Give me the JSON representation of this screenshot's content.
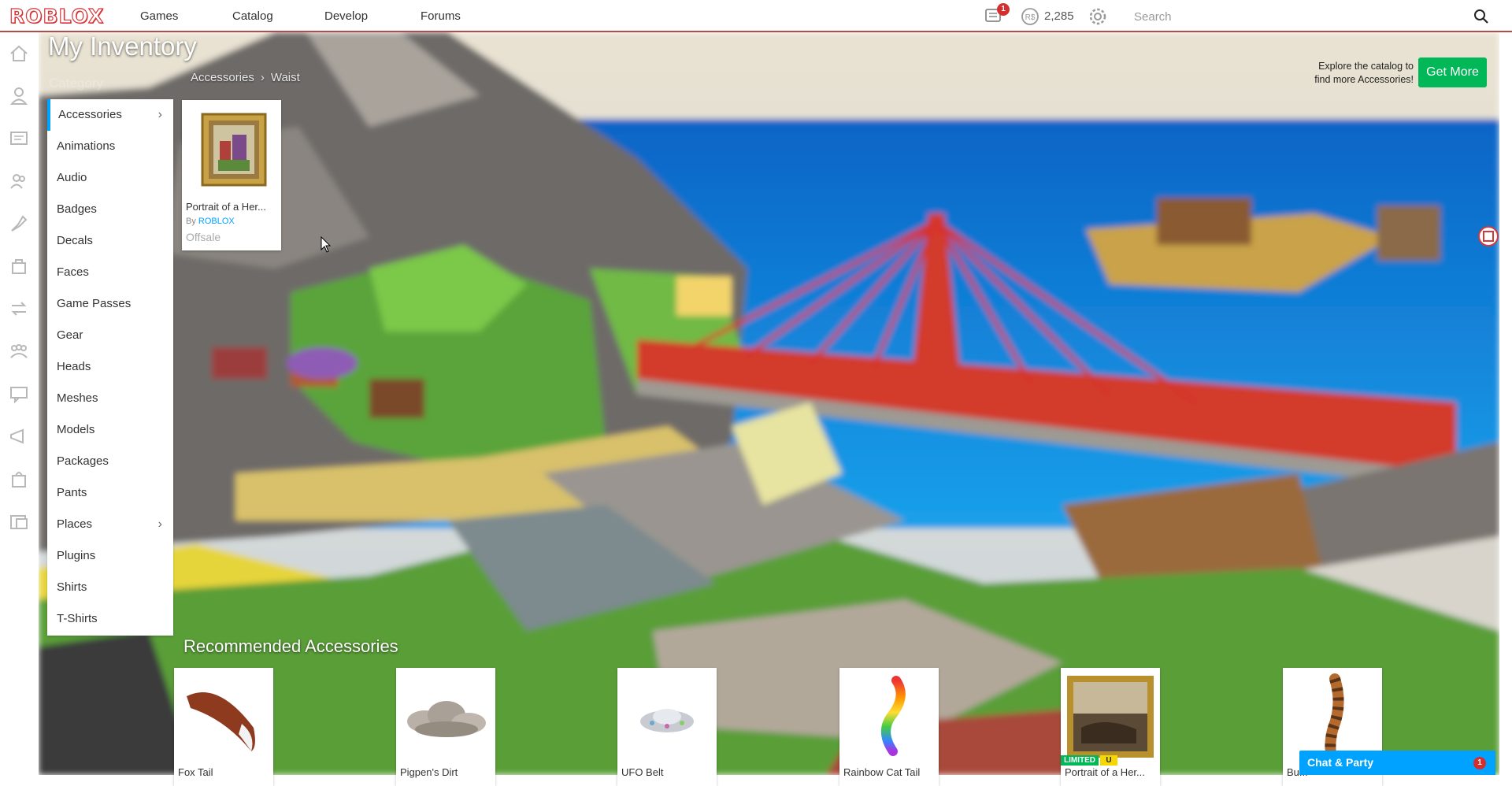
{
  "header": {
    "logo": "ROBLOX",
    "nav": [
      "Games",
      "Catalog",
      "Develop",
      "Forums"
    ],
    "messages_badge": "1",
    "robux": "2,285",
    "search_placeholder": "Search"
  },
  "rail_icons": [
    "home-icon",
    "profile-icon",
    "messages-icon",
    "friends-icon",
    "avatar-icon",
    "inventory-icon",
    "trade-icon",
    "groups-icon",
    "forum-icon",
    "blog-icon",
    "shop-icon",
    "gift-cards-icon"
  ],
  "page": {
    "title": "My Inventory",
    "category_label": "Category",
    "breadcrumb": [
      "Accessories",
      "Waist"
    ]
  },
  "categories": [
    {
      "label": "Accessories",
      "active": true,
      "has_submenu": true
    },
    {
      "label": "Animations"
    },
    {
      "label": "Audio"
    },
    {
      "label": "Badges"
    },
    {
      "label": "Decals"
    },
    {
      "label": "Faces"
    },
    {
      "label": "Game Passes"
    },
    {
      "label": "Gear"
    },
    {
      "label": "Heads"
    },
    {
      "label": "Meshes"
    },
    {
      "label": "Models"
    },
    {
      "label": "Packages"
    },
    {
      "label": "Pants"
    },
    {
      "label": "Places",
      "has_submenu": true
    },
    {
      "label": "Plugins"
    },
    {
      "label": "Shirts"
    },
    {
      "label": "T-Shirts"
    }
  ],
  "inventory_item": {
    "name": "Portrait of a Her...",
    "by_prefix": "By",
    "creator": "ROBLOX",
    "price": "Offsale"
  },
  "explore": {
    "text_line1": "Explore the catalog to",
    "text_line2": "find more Accessories!",
    "button": "Get More"
  },
  "recommended": {
    "title": "Recommended Accessories",
    "items": [
      {
        "name": "Fox Tail",
        "thumb": "fox-tail"
      },
      {
        "name": "Pigpen's Dirt",
        "thumb": "dirt-cloud"
      },
      {
        "name": "UFO Belt",
        "thumb": "ufo"
      },
      {
        "name": "Rainbow Cat Tail",
        "thumb": "rainbow-tail"
      },
      {
        "name": "Portrait of a Her...",
        "thumb": "painting",
        "limited": "LIMITED",
        "limited_u": "U"
      },
      {
        "name": "Bu...",
        "thumb": "striped-tail"
      }
    ]
  },
  "chat": {
    "label": "Chat & Party",
    "count": "1"
  },
  "colors": {
    "accent_blue": "#00a2ff",
    "get_more_green": "#02b757",
    "logo_red": "#d5373a",
    "badge_red": "#d32f2f"
  }
}
